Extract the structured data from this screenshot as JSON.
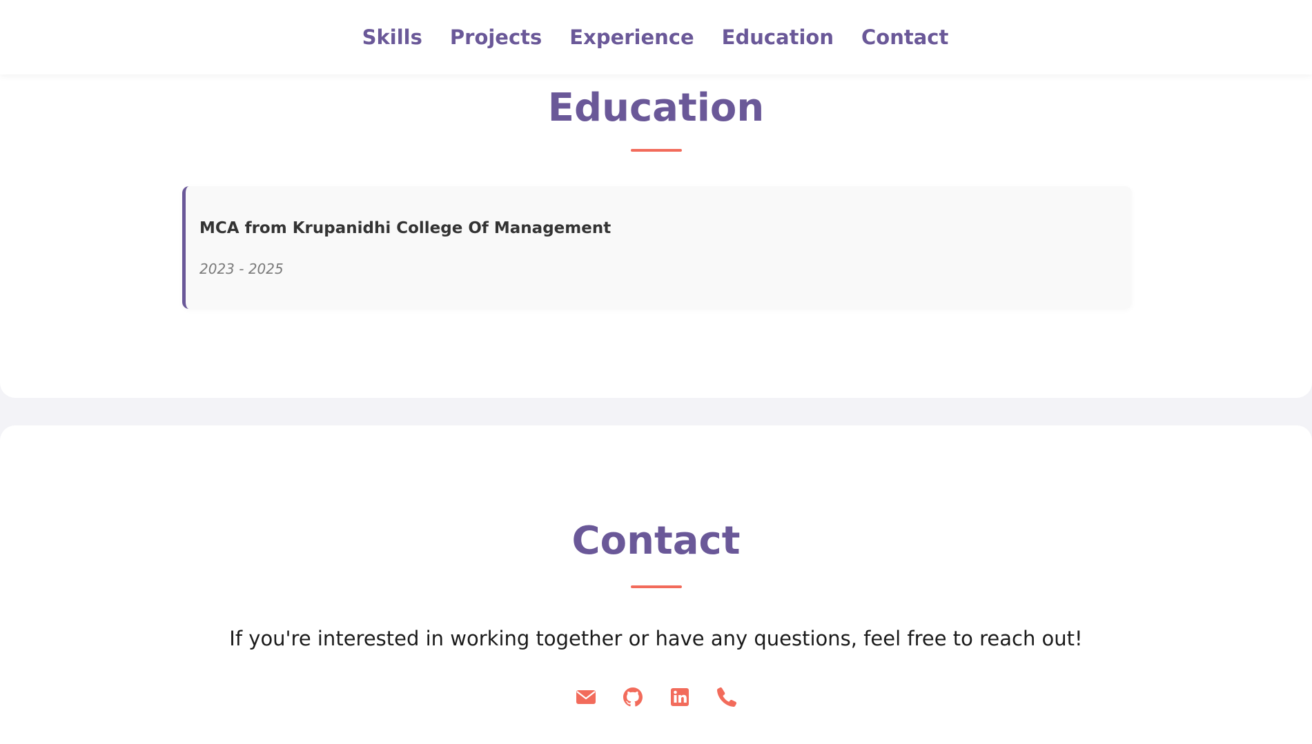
{
  "nav": {
    "items": [
      {
        "label": "Skills"
      },
      {
        "label": "Projects"
      },
      {
        "label": "Experience"
      },
      {
        "label": "Education"
      },
      {
        "label": "Contact"
      }
    ]
  },
  "education": {
    "title": "Education",
    "entries": [
      {
        "degree": "MCA from Krupanidhi College Of Management",
        "years": "2023 - 2025"
      }
    ]
  },
  "contact": {
    "title": "Contact",
    "message": "If you're interested in working together or have any questions, feel free to reach out!",
    "links": [
      {
        "icon": "envelope-icon"
      },
      {
        "icon": "github-icon"
      },
      {
        "icon": "linkedin-icon"
      },
      {
        "icon": "phone-icon"
      }
    ]
  },
  "colors": {
    "primary": "#6a5898",
    "accent": "#f26b5b",
    "page_background": "#f3f3f7",
    "card_background": "#f9f9f9"
  }
}
